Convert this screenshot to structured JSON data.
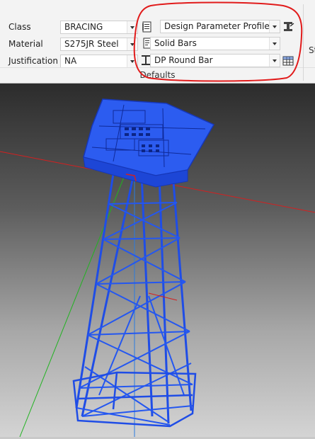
{
  "ribbon": {
    "class_label": "Class",
    "class_value": "BRACING",
    "material_label": "Material",
    "material_value": "S275JR Steel",
    "justification_label": "Justification",
    "justification_value": "NA",
    "profiles_value": "Design Parameter Profiles",
    "shape_value": "Solid Bars",
    "section_value": "DP Round Bar",
    "group_label": "Defaults",
    "overflow_label": "St"
  },
  "colors": {
    "model": "#1f4de6",
    "annotation": "#e11b1b",
    "axis_x": "#d42020",
    "axis_y": "#21b321"
  }
}
